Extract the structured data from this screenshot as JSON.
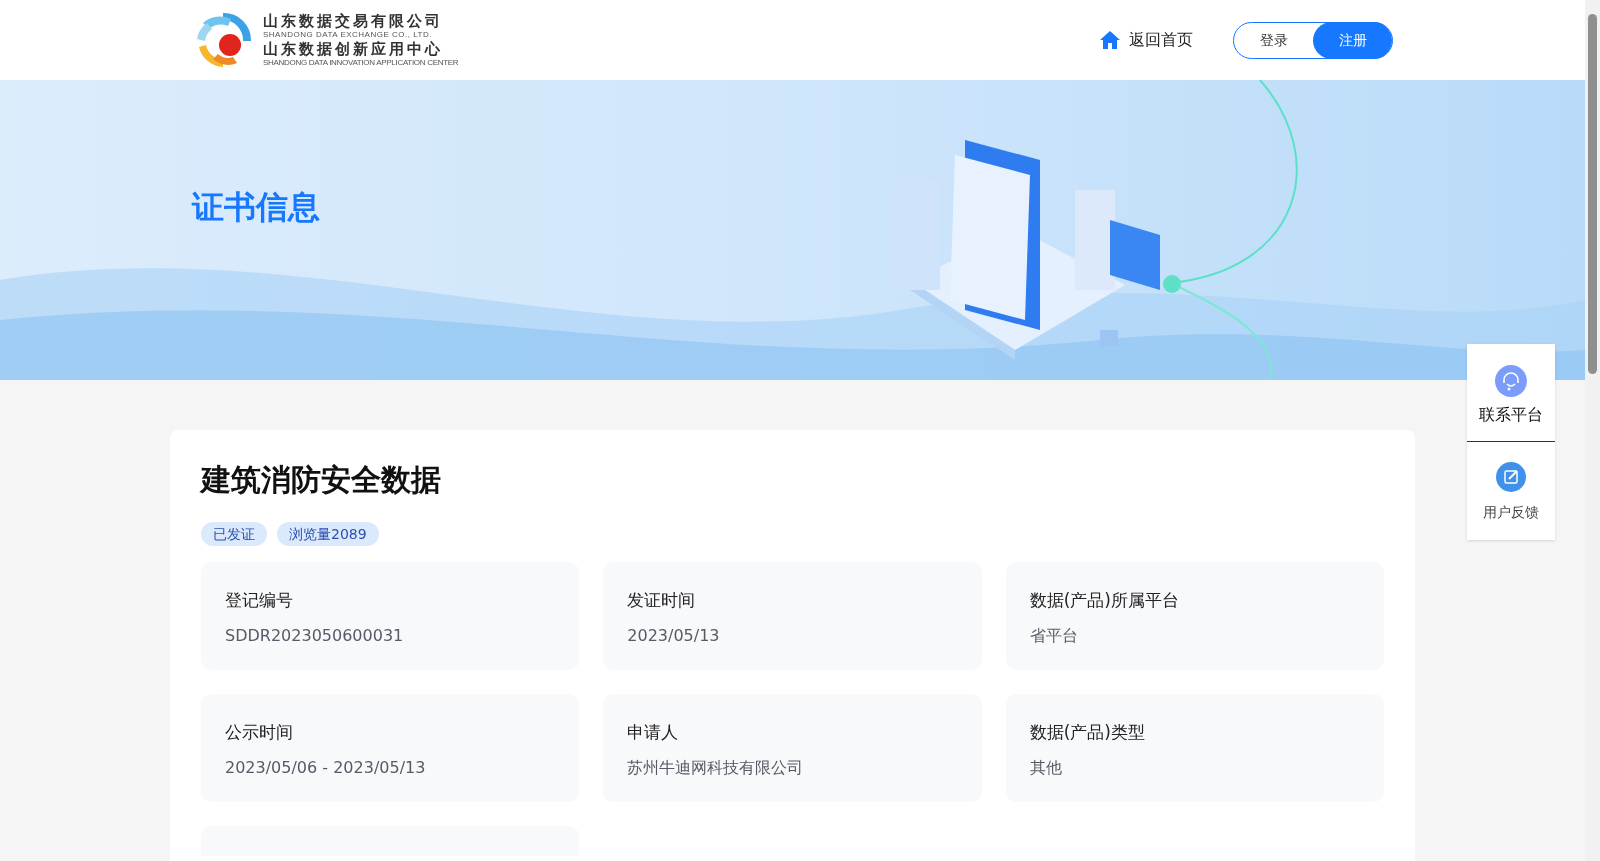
{
  "header": {
    "logo": {
      "line_1": "山东数据交易有限公司",
      "line_2": "SHANDONG DATA EXCHANGE CO., LTD.",
      "line_3": "山东数据创新应用中心",
      "line_4": "SHANDONG DATA INNOVATION APPLICATION CENTER"
    },
    "home_link": "返回首页",
    "auth_buttons": [
      {
        "label": "登录",
        "kind": "outline"
      },
      {
        "label": "注册",
        "kind": "filled"
      }
    ]
  },
  "banner": {
    "title": "证书信息"
  },
  "detail": {
    "title": "建筑消防安全数据",
    "tags": [
      "已发证",
      "浏览量2089"
    ],
    "fields": [
      {
        "label": "登记编号",
        "value": "SDDR2023050600031"
      },
      {
        "label": "发证时间",
        "value": "2023/05/13"
      },
      {
        "label": "数据(产品)所属平台",
        "value": "省平台"
      },
      {
        "label": "公示时间",
        "value": "2023/05/06 - 2023/05/13"
      },
      {
        "label": "申请人",
        "value": "苏州牛迪网科技有限公司"
      },
      {
        "label": "数据(产品)类型",
        "value": "其他"
      }
    ]
  },
  "side_panel": [
    {
      "label": "联系平台",
      "kind": "contact"
    },
    {
      "label": "用户反馈",
      "kind": "feedback"
    }
  ]
}
